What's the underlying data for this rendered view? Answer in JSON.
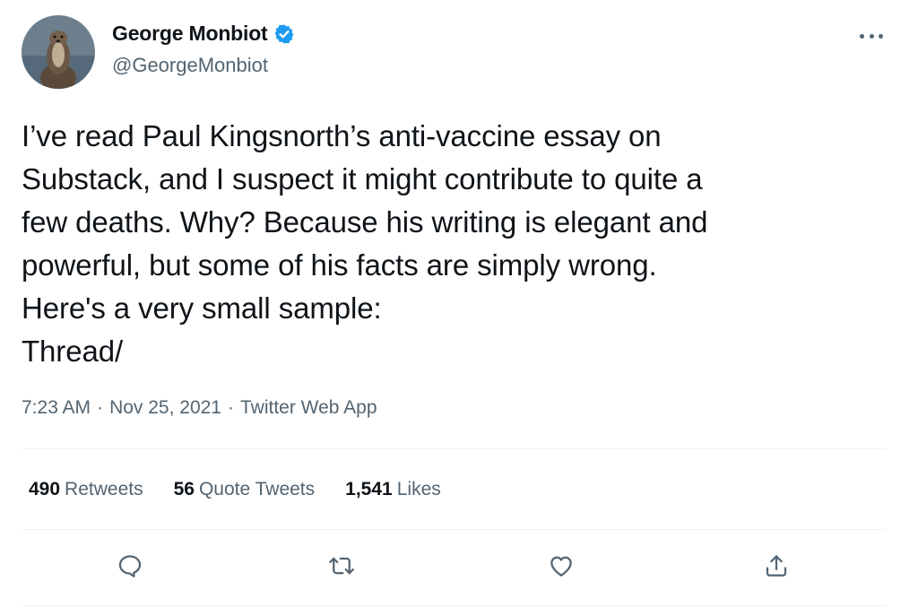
{
  "author": {
    "display_name": "George Monbiot",
    "handle": "@GeorgeMonbiot",
    "verified": true,
    "avatar_icon": "otter-avatar"
  },
  "tweet": {
    "text": "I’ve read Paul Kingsnorth’s anti-vaccine essay on\nSubstack, and I suspect it might contribute to quite a\nfew deaths. Why? Because his writing is elegant and\npowerful, but some of his facts are simply wrong.\nHere's a very small sample:\nThread/",
    "time": "7:23 AM",
    "date": "Nov 25, 2021",
    "source": "Twitter Web App",
    "separator": "·"
  },
  "stats": {
    "retweets_count": "490",
    "retweets_label": "Retweets",
    "quote_tweets_count": "56",
    "quote_tweets_label": "Quote Tweets",
    "likes_count": "1,541",
    "likes_label": "Likes"
  },
  "actions": [
    "reply-icon",
    "retweet-icon",
    "like-icon",
    "share-icon"
  ],
  "colors": {
    "text": "#0f1419",
    "secondary": "#536471",
    "verified": "#1d9bf0",
    "divider": "#eff3f4"
  }
}
